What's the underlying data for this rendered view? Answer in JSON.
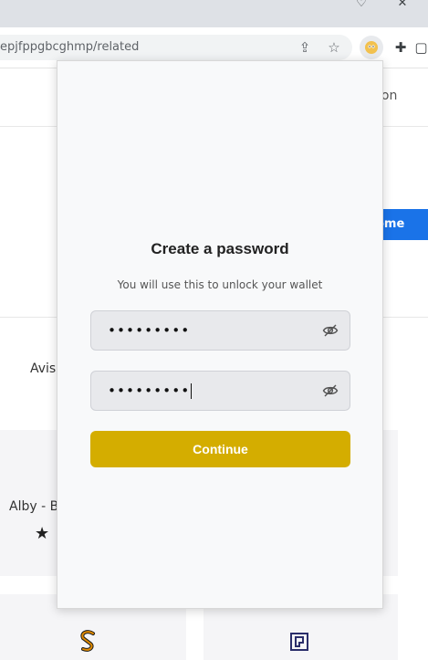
{
  "browser": {
    "url": "epjfppgbcghmp/related",
    "icons": {
      "heart": "heart-icon",
      "close": "close-icon",
      "share": "share-icon",
      "bookmark": "star-icon",
      "extension_active": "alby-extension-icon",
      "extensions": "puzzle-icon"
    }
  },
  "page": {
    "header_partial": "ion",
    "button_partial": "ome",
    "avis_partial": "Avis",
    "card1_title_partial": "Alby - B",
    "card1_rating_icon": "star-icon"
  },
  "popup": {
    "title": "Create a password",
    "subtitle": "You will use this to unlock your wallet",
    "password": {
      "value_masked": "•••••••••",
      "icon": "eye-off-icon"
    },
    "confirm_password": {
      "value_masked": "•••••••••",
      "icon": "eye-off-icon"
    },
    "continue_label": "Continue",
    "accent_color": "#d4ad00"
  }
}
